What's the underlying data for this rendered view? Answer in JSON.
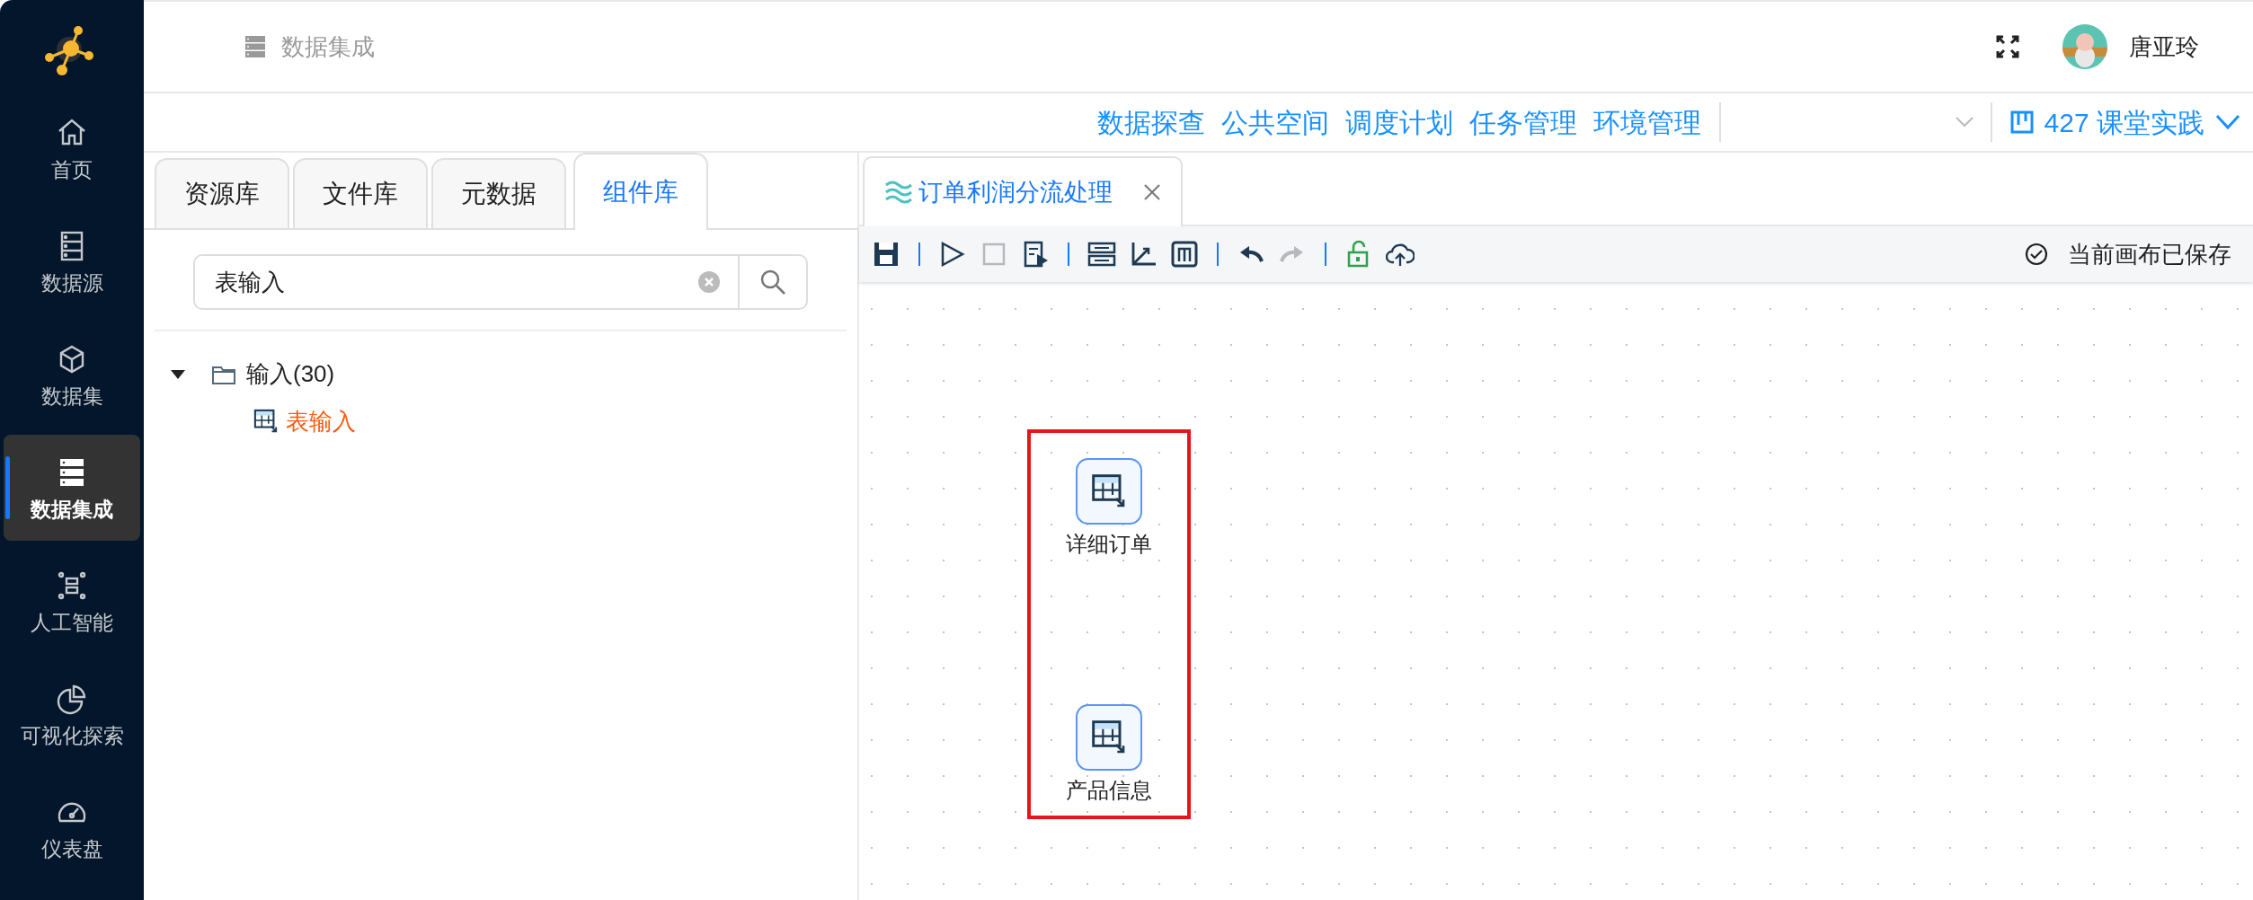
{
  "sidebar": {
    "items": [
      {
        "label": "首页",
        "selected": false
      },
      {
        "label": "数据源",
        "selected": false
      },
      {
        "label": "数据集",
        "selected": false
      },
      {
        "label": "数据集成",
        "selected": true
      },
      {
        "label": "人工智能",
        "selected": false
      },
      {
        "label": "可视化探索",
        "selected": false
      },
      {
        "label": "仪表盘",
        "selected": false
      }
    ]
  },
  "header": {
    "title": "数据集成",
    "user": "唐亚玲"
  },
  "nav": {
    "links": [
      "数据探查",
      "公共空间",
      "调度计划",
      "任务管理",
      "环境管理"
    ],
    "project": "427 课堂实践"
  },
  "left_panel": {
    "tabs": [
      {
        "label": "资源库",
        "selected": false
      },
      {
        "label": "文件库",
        "selected": false
      },
      {
        "label": "元数据",
        "selected": false
      },
      {
        "label": "组件库",
        "selected": true
      }
    ],
    "search": {
      "value": "表输入"
    },
    "tree": [
      {
        "label": "输入(30)",
        "expanded": true,
        "children": [
          {
            "label": "表输入",
            "highlighted": true
          }
        ]
      }
    ]
  },
  "editor": {
    "tabs": [
      {
        "label": "订单利润分流处理",
        "selected": true
      }
    ],
    "toolbar": [
      {
        "kind": "save",
        "disabled": false
      },
      {
        "kind": "separator"
      },
      {
        "kind": "run",
        "disabled": false
      },
      {
        "kind": "stop",
        "disabled": true
      },
      {
        "kind": "step",
        "disabled": false
      },
      {
        "kind": "separator"
      },
      {
        "kind": "layout",
        "disabled": false
      },
      {
        "kind": "axis",
        "disabled": false
      },
      {
        "kind": "mbox",
        "disabled": false
      },
      {
        "kind": "separator"
      },
      {
        "kind": "undo",
        "disabled": false
      },
      {
        "kind": "redo",
        "disabled": true
      },
      {
        "kind": "separator"
      },
      {
        "kind": "lock",
        "disabled": false
      },
      {
        "kind": "upload",
        "disabled": false
      }
    ],
    "status": "当前画布已保存",
    "canvas": {
      "marquee": true,
      "nodes": [
        {
          "label": "详细订单",
          "selected": true
        },
        {
          "label": "产品信息",
          "selected": true
        }
      ]
    }
  }
}
